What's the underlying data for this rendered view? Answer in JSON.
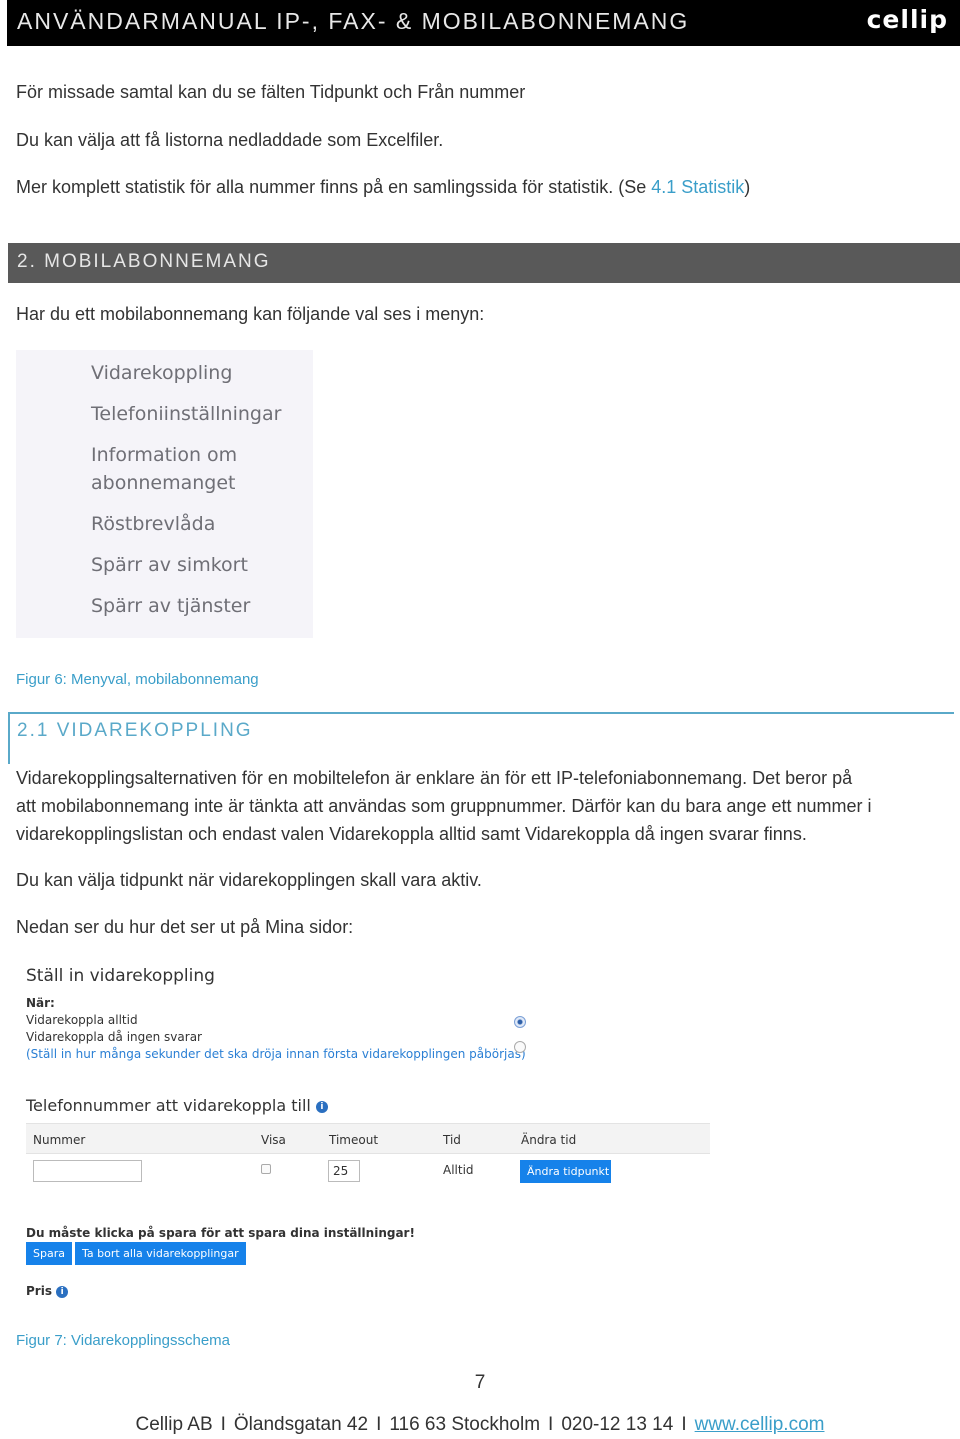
{
  "header": {
    "title": "ANVÄNDARMANUAL IP-, FAX- & MOBILABONNEMANG",
    "logo": "cellip"
  },
  "intro": {
    "p1": "För missade samtal kan du se fälten Tidpunkt och Från nummer",
    "p2": "Du kan välja att få listorna nedladdade som Excelfiler.",
    "p3_prefix": "Mer komplett statistik för alla nummer finns på en samlingssida för statistik. (Se ",
    "p3_link": "4.1 Statistik",
    "p3_suffix": ")"
  },
  "section2": {
    "heading": "2. MOBILABONNEMANG",
    "intro": "Har du ett mobilabonnemang kan följande val ses i menyn:",
    "menu_items": [
      "Vidarekoppling",
      "Telefoniinställningar",
      "Information om",
      "abonnemanget",
      "Röstbrevlåda",
      "Spärr av simkort",
      "Spärr av tjänster"
    ],
    "figure_caption": "Figur 6: Menyval, mobilabonnemang"
  },
  "section21": {
    "heading": "2.1 VIDAREKOPPLING",
    "paragraph1_lines": [
      "Vidarekopplingsalternativen för en mobiltelefon är enklare än för ett IP-telefoniabonnemang. Det beror på",
      "att mobilabonnemang inte är tänkta att användas som gruppnummer. Därför kan du bara ange ett nummer i",
      "vidarekopplingslistan och endast valen Vidarekoppla alltid samt Vidarekoppla då ingen svarar finns."
    ],
    "paragraph2": "Du kan välja tidpunkt när vidarekopplingen skall vara aktiv.",
    "paragraph3": "Nedan ser du hur det ser ut på Mina sidor:",
    "figure_caption": "Figur 7: Vidarekopplingsschema"
  },
  "forwarding_form": {
    "title": "Ställ in vidarekoppling",
    "when_label": "När:",
    "options": [
      {
        "label": "Vidarekoppla alltid",
        "selected": true
      },
      {
        "label": "Vidarekoppla då ingen svarar",
        "selected": false
      }
    ],
    "hint": "(Ställ in hur många sekunder det ska dröja innan första vidarekopplingen påbörjas)",
    "numbers_title": "Telefonnummer att vidarekoppla till",
    "info_icon": "i",
    "table": {
      "headers": [
        "Nummer",
        "Visa",
        "Timeout",
        "Tid",
        "Ändra tid"
      ],
      "row": {
        "nummer": "",
        "visa": false,
        "timeout": "25",
        "tid": "Alltid",
        "button": "Ändra tidpunkt"
      }
    },
    "save_notice": "Du måste klicka på spara för att spara dina inställningar!",
    "save_button": "Spara",
    "remove_all_button": "Ta bort alla vidarekopplingar",
    "price_label": "Pris"
  },
  "footer": {
    "page_number": "7",
    "company": "Cellip AB",
    "address": "Ölandsgatan 42",
    "city": "116 63 Stockholm",
    "phone": "020-12 13 14",
    "website": "www.cellip.com",
    "separator": "I"
  },
  "colors": {
    "accent_blue": "#3a9ec9",
    "button_blue": "#1682ea",
    "section_grey": "#595959"
  }
}
